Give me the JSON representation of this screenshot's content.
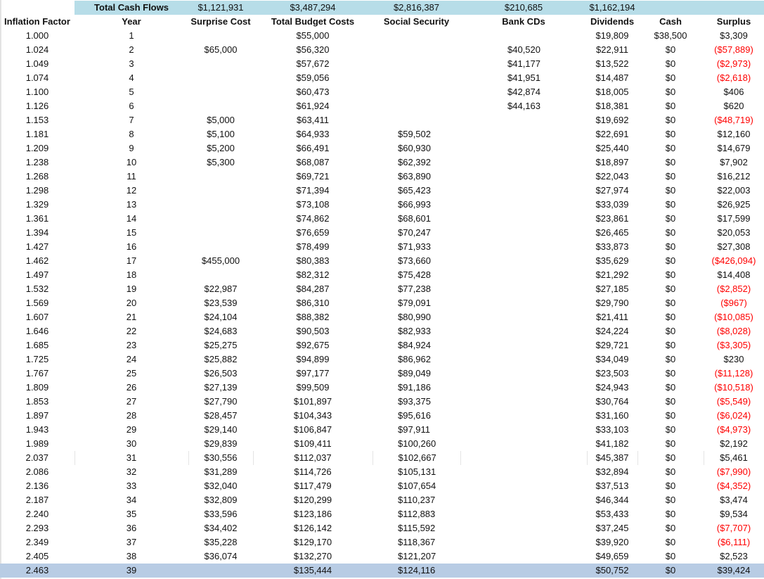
{
  "totals": {
    "label": "Total Cash Flows",
    "surprise_cost": "$1,121,931",
    "total_budget_costs": "$3,487,294",
    "social_security": "$2,816,387",
    "bank_cds": "$210,685",
    "dividends": "$1,162,194"
  },
  "headers": [
    "Inflation Factor",
    "Year",
    "Surprise Cost",
    "Total Budget Costs",
    "Social Security",
    "Bank CDs",
    "Dividends",
    "Cash",
    "Surplus"
  ],
  "colors": {
    "totals_band": "#b7dde8",
    "selected_row": "#b8cce4",
    "negative": "#ff0000"
  },
  "rows": [
    [
      "1.000",
      "1",
      "",
      "$55,000",
      "",
      "",
      "$19,809",
      "$38,500",
      "$3,309"
    ],
    [
      "1.024",
      "2",
      "$65,000",
      "$56,320",
      "",
      "$40,520",
      "$22,911",
      "$0",
      "($57,889)"
    ],
    [
      "1.049",
      "3",
      "",
      "$57,672",
      "",
      "$41,177",
      "$13,522",
      "$0",
      "($2,973)"
    ],
    [
      "1.074",
      "4",
      "",
      "$59,056",
      "",
      "$41,951",
      "$14,487",
      "$0",
      "($2,618)"
    ],
    [
      "1.100",
      "5",
      "",
      "$60,473",
      "",
      "$42,874",
      "$18,005",
      "$0",
      "$406"
    ],
    [
      "1.126",
      "6",
      "",
      "$61,924",
      "",
      "$44,163",
      "$18,381",
      "$0",
      "$620"
    ],
    [
      "1.153",
      "7",
      "$5,000",
      "$63,411",
      "",
      "",
      "$19,692",
      "$0",
      "($48,719)"
    ],
    [
      "1.181",
      "8",
      "$5,100",
      "$64,933",
      "$59,502",
      "",
      "$22,691",
      "$0",
      "$12,160"
    ],
    [
      "1.209",
      "9",
      "$5,200",
      "$66,491",
      "$60,930",
      "",
      "$25,440",
      "$0",
      "$14,679"
    ],
    [
      "1.238",
      "10",
      "$5,300",
      "$68,087",
      "$62,392",
      "",
      "$18,897",
      "$0",
      "$7,902"
    ],
    [
      "1.268",
      "11",
      "",
      "$69,721",
      "$63,890",
      "",
      "$22,043",
      "$0",
      "$16,212"
    ],
    [
      "1.298",
      "12",
      "",
      "$71,394",
      "$65,423",
      "",
      "$27,974",
      "$0",
      "$22,003"
    ],
    [
      "1.329",
      "13",
      "",
      "$73,108",
      "$66,993",
      "",
      "$33,039",
      "$0",
      "$26,925"
    ],
    [
      "1.361",
      "14",
      "",
      "$74,862",
      "$68,601",
      "",
      "$23,861",
      "$0",
      "$17,599"
    ],
    [
      "1.394",
      "15",
      "",
      "$76,659",
      "$70,247",
      "",
      "$26,465",
      "$0",
      "$20,053"
    ],
    [
      "1.427",
      "16",
      "",
      "$78,499",
      "$71,933",
      "",
      "$33,873",
      "$0",
      "$27,308"
    ],
    [
      "1.462",
      "17",
      "$455,000",
      "$80,383",
      "$73,660",
      "",
      "$35,629",
      "$0",
      "($426,094)"
    ],
    [
      "1.497",
      "18",
      "",
      "$82,312",
      "$75,428",
      "",
      "$21,292",
      "$0",
      "$14,408"
    ],
    [
      "1.532",
      "19",
      "$22,987",
      "$84,287",
      "$77,238",
      "",
      "$27,185",
      "$0",
      "($2,852)"
    ],
    [
      "1.569",
      "20",
      "$23,539",
      "$86,310",
      "$79,091",
      "",
      "$29,790",
      "$0",
      "($967)"
    ],
    [
      "1.607",
      "21",
      "$24,104",
      "$88,382",
      "$80,990",
      "",
      "$21,411",
      "$0",
      "($10,085)"
    ],
    [
      "1.646",
      "22",
      "$24,683",
      "$90,503",
      "$82,933",
      "",
      "$24,224",
      "$0",
      "($8,028)"
    ],
    [
      "1.685",
      "23",
      "$25,275",
      "$92,675",
      "$84,924",
      "",
      "$29,721",
      "$0",
      "($3,305)"
    ],
    [
      "1.725",
      "24",
      "$25,882",
      "$94,899",
      "$86,962",
      "",
      "$34,049",
      "$0",
      "$230"
    ],
    [
      "1.767",
      "25",
      "$26,503",
      "$97,177",
      "$89,049",
      "",
      "$23,503",
      "$0",
      "($11,128)"
    ],
    [
      "1.809",
      "26",
      "$27,139",
      "$99,509",
      "$91,186",
      "",
      "$24,943",
      "$0",
      "($10,518)"
    ],
    [
      "1.853",
      "27",
      "$27,790",
      "$101,897",
      "$93,375",
      "",
      "$30,764",
      "$0",
      "($5,549)"
    ],
    [
      "1.897",
      "28",
      "$28,457",
      "$104,343",
      "$95,616",
      "",
      "$31,160",
      "$0",
      "($6,024)"
    ],
    [
      "1.943",
      "29",
      "$29,140",
      "$106,847",
      "$97,911",
      "",
      "$33,103",
      "$0",
      "($4,973)"
    ],
    [
      "1.989",
      "30",
      "$29,839",
      "$109,411",
      "$100,260",
      "",
      "$41,182",
      "$0",
      "$2,192"
    ],
    [
      "2.037",
      "31",
      "$30,556",
      "$112,037",
      "$102,667",
      "",
      "$45,387",
      "$0",
      "$5,461"
    ],
    [
      "2.086",
      "32",
      "$31,289",
      "$114,726",
      "$105,131",
      "",
      "$32,894",
      "$0",
      "($7,990)"
    ],
    [
      "2.136",
      "33",
      "$32,040",
      "$117,479",
      "$107,654",
      "",
      "$37,513",
      "$0",
      "($4,352)"
    ],
    [
      "2.187",
      "34",
      "$32,809",
      "$120,299",
      "$110,237",
      "",
      "$46,344",
      "$0",
      "$3,474"
    ],
    [
      "2.240",
      "35",
      "$33,596",
      "$123,186",
      "$112,883",
      "",
      "$53,433",
      "$0",
      "$9,534"
    ],
    [
      "2.293",
      "36",
      "$34,402",
      "$126,142",
      "$115,592",
      "",
      "$37,245",
      "$0",
      "($7,707)"
    ],
    [
      "2.349",
      "37",
      "$35,228",
      "$129,170",
      "$118,367",
      "",
      "$39,920",
      "$0",
      "($6,111)"
    ],
    [
      "2.405",
      "38",
      "$36,074",
      "$132,270",
      "$121,207",
      "",
      "$49,659",
      "$0",
      "$2,523"
    ],
    [
      "2.463",
      "39",
      "",
      "$135,444",
      "$124,116",
      "",
      "$50,752",
      "$0",
      "$39,424"
    ]
  ]
}
